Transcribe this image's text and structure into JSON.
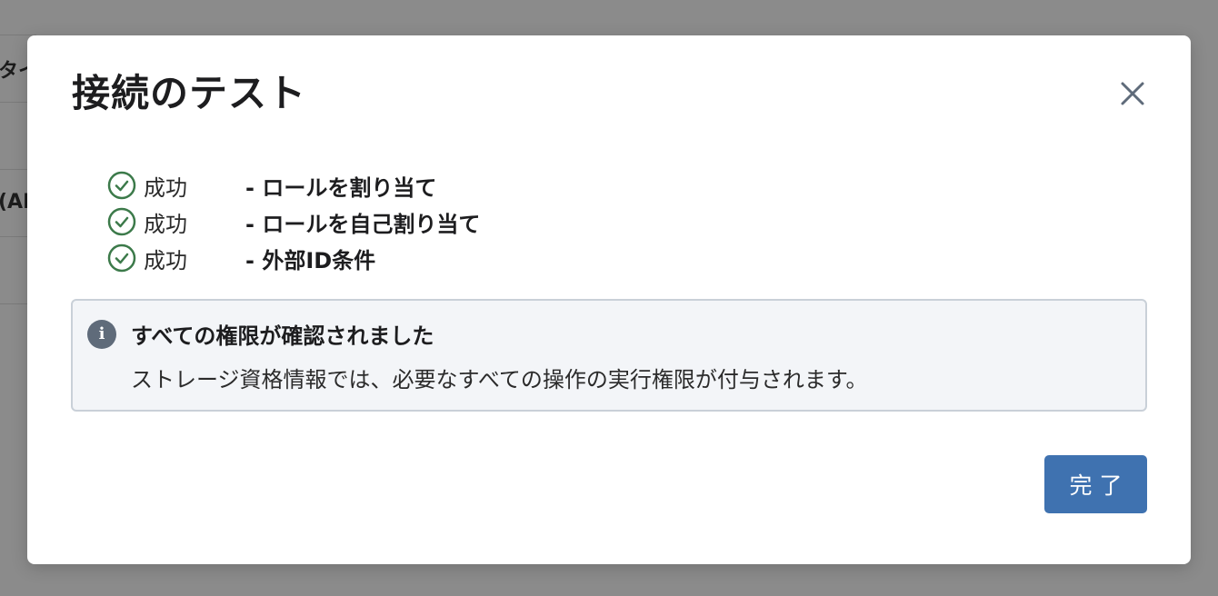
{
  "background": {
    "fragments": [
      "タイ",
      "(AI"
    ]
  },
  "modal": {
    "title": "接続のテスト",
    "close_icon": "close-icon",
    "results": [
      {
        "status": "成功",
        "name": "- ロールを割り当て",
        "icon": "check-circle-icon"
      },
      {
        "status": "成功",
        "name": "- ロールを自己割り当て",
        "icon": "check-circle-icon"
      },
      {
        "status": "成功",
        "name": "- 外部ID条件",
        "icon": "check-circle-icon"
      }
    ],
    "info": {
      "icon_glyph": "i",
      "title": "すべての権限が確認されました",
      "description": "ストレージ資格情報では、必要なすべての操作の実行権限が付与されます。"
    },
    "done_label": "完了"
  },
  "colors": {
    "overlay": "#8b8b8b",
    "success": "#3c7a4a",
    "primary_button": "#3f72b0",
    "info_bg": "#f3f5f8",
    "info_border": "#c9d0d8",
    "info_icon": "#5f6b7a"
  }
}
